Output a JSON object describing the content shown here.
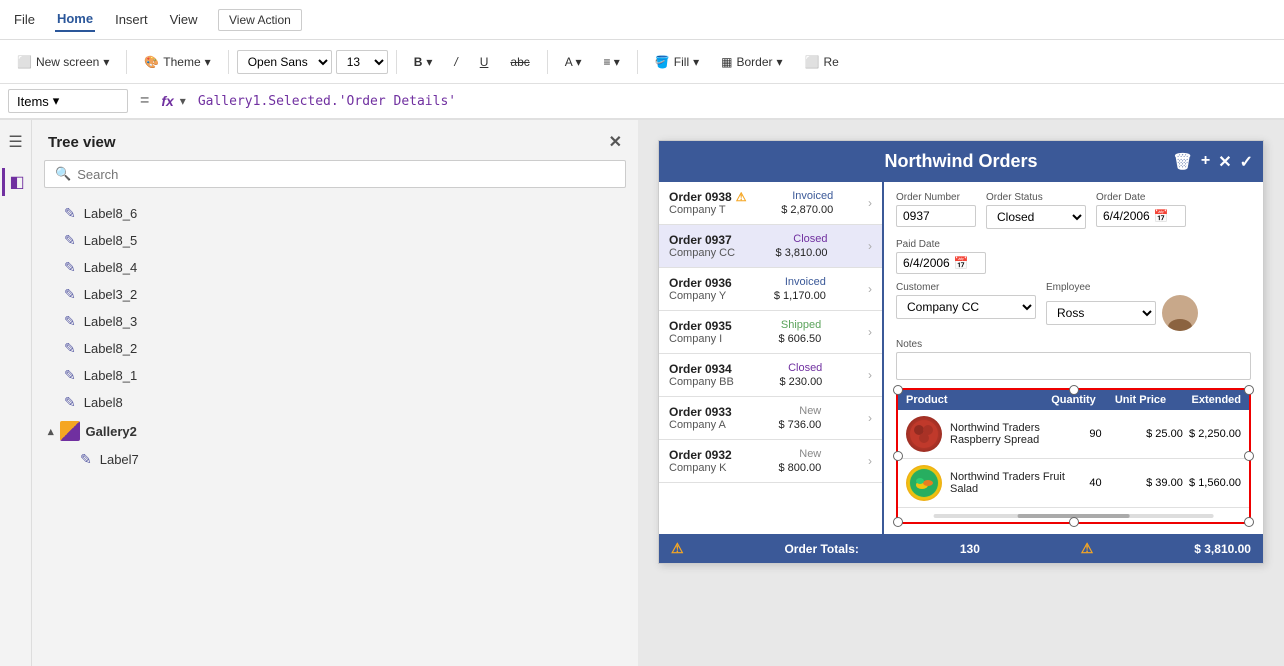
{
  "menu": {
    "items": [
      {
        "label": "File",
        "active": false
      },
      {
        "label": "Home",
        "active": true
      },
      {
        "label": "Insert",
        "active": false
      },
      {
        "label": "View",
        "active": false
      },
      {
        "label": "Action",
        "active": false
      }
    ],
    "view_action_label": "View Action"
  },
  "toolbar": {
    "new_screen_label": "New screen",
    "theme_label": "Theme",
    "font_label": "Open Sans",
    "font_size": "13",
    "fill_label": "Fill",
    "border_label": "Border",
    "re_label": "Re"
  },
  "formula_bar": {
    "dropdown_label": "Items",
    "fx_symbol": "fx",
    "formula_text": "Gallery1.Selected.'Order Details'"
  },
  "sidebar": {
    "tree_view_label": "Tree view",
    "search_placeholder": "Search",
    "items": [
      {
        "label": "Label8_6",
        "type": "label"
      },
      {
        "label": "Label8_5",
        "type": "label"
      },
      {
        "label": "Label8_4",
        "type": "label"
      },
      {
        "label": "Label3_2",
        "type": "label"
      },
      {
        "label": "Label8_3",
        "type": "label"
      },
      {
        "label": "Label8_2",
        "type": "label"
      },
      {
        "label": "Label8_1",
        "type": "label"
      },
      {
        "label": "Label8",
        "type": "label"
      },
      {
        "label": "Gallery2",
        "type": "gallery",
        "expanded": true
      },
      {
        "label": "Label7",
        "type": "label"
      }
    ]
  },
  "app": {
    "title": "Northwind Orders",
    "order_list": [
      {
        "num": "Order 0938",
        "company": "Company T",
        "status": "Invoiced",
        "status_type": "invoiced",
        "amount": "$ 2,870.00",
        "warn": true
      },
      {
        "num": "Order 0937",
        "company": "Company CC",
        "status": "Closed",
        "status_type": "closed",
        "amount": "$ 3,810.00",
        "warn": false
      },
      {
        "num": "Order 0936",
        "company": "Company Y",
        "status": "Invoiced",
        "status_type": "invoiced",
        "amount": "$ 1,170.00",
        "warn": false
      },
      {
        "num": "Order 0935",
        "company": "Company I",
        "status": "Shipped",
        "status_type": "shipped",
        "amount": "$ 606.50",
        "warn": false
      },
      {
        "num": "Order 0934",
        "company": "Company BB",
        "status": "Closed",
        "status_type": "closed",
        "amount": "$ 230.00",
        "warn": false
      },
      {
        "num": "Order 0933",
        "company": "Company A",
        "status": "New",
        "status_type": "new",
        "amount": "$ 736.00",
        "warn": false
      },
      {
        "num": "Order 0932",
        "company": "Company K",
        "status": "New",
        "status_type": "new",
        "amount": "$ 800.00",
        "warn": false
      }
    ],
    "detail": {
      "order_number_label": "Order Number",
      "order_number_value": "0937",
      "order_status_label": "Order Status",
      "order_status_value": "Closed",
      "order_date_label": "Order Date",
      "order_date_value": "6/4/2006",
      "paid_date_label": "Paid Date",
      "paid_date_value": "6/4/2006",
      "customer_label": "Customer",
      "customer_value": "Company CC",
      "employee_label": "Employee",
      "employee_value": "Ross",
      "notes_label": "Notes",
      "notes_value": ""
    },
    "products": {
      "header": {
        "product_label": "Product",
        "quantity_label": "Quantity",
        "unit_price_label": "Unit Price",
        "extended_label": "Extended"
      },
      "rows": [
        {
          "name": "Northwind Traders Raspberry Spread",
          "qty": "90",
          "price": "$ 25.00",
          "extended": "$ 2,250.00",
          "img_type": "raspberry"
        },
        {
          "name": "Northwind Traders Fruit Salad",
          "qty": "40",
          "price": "$ 39.00",
          "extended": "$ 1,560.00",
          "img_type": "salad"
        }
      ]
    },
    "footer": {
      "order_totals_label": "Order Totals:",
      "total_qty": "130",
      "total_extended": "$ 3,810.00"
    }
  }
}
